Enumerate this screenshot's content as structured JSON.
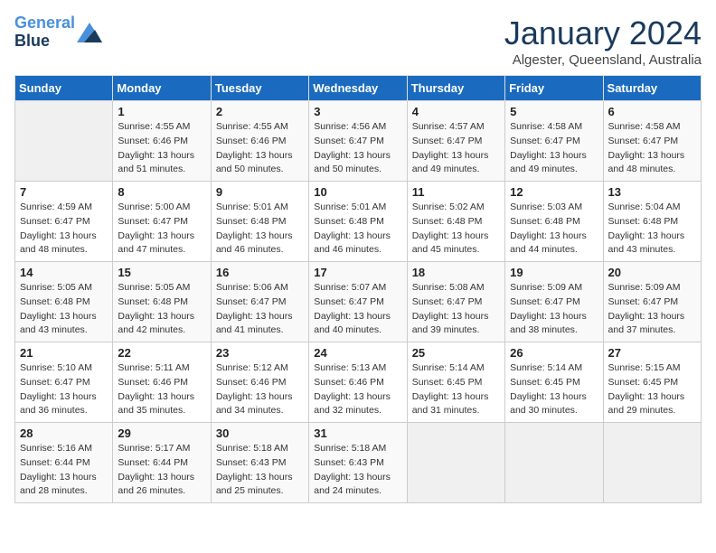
{
  "header": {
    "logo_line1": "General",
    "logo_line2": "Blue",
    "month": "January 2024",
    "location": "Algester, Queensland, Australia"
  },
  "weekdays": [
    "Sunday",
    "Monday",
    "Tuesday",
    "Wednesday",
    "Thursday",
    "Friday",
    "Saturday"
  ],
  "weeks": [
    [
      {
        "day": "",
        "info": ""
      },
      {
        "day": "1",
        "info": "Sunrise: 4:55 AM\nSunset: 6:46 PM\nDaylight: 13 hours\nand 51 minutes."
      },
      {
        "day": "2",
        "info": "Sunrise: 4:55 AM\nSunset: 6:46 PM\nDaylight: 13 hours\nand 50 minutes."
      },
      {
        "day": "3",
        "info": "Sunrise: 4:56 AM\nSunset: 6:47 PM\nDaylight: 13 hours\nand 50 minutes."
      },
      {
        "day": "4",
        "info": "Sunrise: 4:57 AM\nSunset: 6:47 PM\nDaylight: 13 hours\nand 49 minutes."
      },
      {
        "day": "5",
        "info": "Sunrise: 4:58 AM\nSunset: 6:47 PM\nDaylight: 13 hours\nand 49 minutes."
      },
      {
        "day": "6",
        "info": "Sunrise: 4:58 AM\nSunset: 6:47 PM\nDaylight: 13 hours\nand 48 minutes."
      }
    ],
    [
      {
        "day": "7",
        "info": "Sunrise: 4:59 AM\nSunset: 6:47 PM\nDaylight: 13 hours\nand 48 minutes."
      },
      {
        "day": "8",
        "info": "Sunrise: 5:00 AM\nSunset: 6:47 PM\nDaylight: 13 hours\nand 47 minutes."
      },
      {
        "day": "9",
        "info": "Sunrise: 5:01 AM\nSunset: 6:48 PM\nDaylight: 13 hours\nand 46 minutes."
      },
      {
        "day": "10",
        "info": "Sunrise: 5:01 AM\nSunset: 6:48 PM\nDaylight: 13 hours\nand 46 minutes."
      },
      {
        "day": "11",
        "info": "Sunrise: 5:02 AM\nSunset: 6:48 PM\nDaylight: 13 hours\nand 45 minutes."
      },
      {
        "day": "12",
        "info": "Sunrise: 5:03 AM\nSunset: 6:48 PM\nDaylight: 13 hours\nand 44 minutes."
      },
      {
        "day": "13",
        "info": "Sunrise: 5:04 AM\nSunset: 6:48 PM\nDaylight: 13 hours\nand 43 minutes."
      }
    ],
    [
      {
        "day": "14",
        "info": "Sunrise: 5:05 AM\nSunset: 6:48 PM\nDaylight: 13 hours\nand 43 minutes."
      },
      {
        "day": "15",
        "info": "Sunrise: 5:05 AM\nSunset: 6:48 PM\nDaylight: 13 hours\nand 42 minutes."
      },
      {
        "day": "16",
        "info": "Sunrise: 5:06 AM\nSunset: 6:47 PM\nDaylight: 13 hours\nand 41 minutes."
      },
      {
        "day": "17",
        "info": "Sunrise: 5:07 AM\nSunset: 6:47 PM\nDaylight: 13 hours\nand 40 minutes."
      },
      {
        "day": "18",
        "info": "Sunrise: 5:08 AM\nSunset: 6:47 PM\nDaylight: 13 hours\nand 39 minutes."
      },
      {
        "day": "19",
        "info": "Sunrise: 5:09 AM\nSunset: 6:47 PM\nDaylight: 13 hours\nand 38 minutes."
      },
      {
        "day": "20",
        "info": "Sunrise: 5:09 AM\nSunset: 6:47 PM\nDaylight: 13 hours\nand 37 minutes."
      }
    ],
    [
      {
        "day": "21",
        "info": "Sunrise: 5:10 AM\nSunset: 6:47 PM\nDaylight: 13 hours\nand 36 minutes."
      },
      {
        "day": "22",
        "info": "Sunrise: 5:11 AM\nSunset: 6:46 PM\nDaylight: 13 hours\nand 35 minutes."
      },
      {
        "day": "23",
        "info": "Sunrise: 5:12 AM\nSunset: 6:46 PM\nDaylight: 13 hours\nand 34 minutes."
      },
      {
        "day": "24",
        "info": "Sunrise: 5:13 AM\nSunset: 6:46 PM\nDaylight: 13 hours\nand 32 minutes."
      },
      {
        "day": "25",
        "info": "Sunrise: 5:14 AM\nSunset: 6:45 PM\nDaylight: 13 hours\nand 31 minutes."
      },
      {
        "day": "26",
        "info": "Sunrise: 5:14 AM\nSunset: 6:45 PM\nDaylight: 13 hours\nand 30 minutes."
      },
      {
        "day": "27",
        "info": "Sunrise: 5:15 AM\nSunset: 6:45 PM\nDaylight: 13 hours\nand 29 minutes."
      }
    ],
    [
      {
        "day": "28",
        "info": "Sunrise: 5:16 AM\nSunset: 6:44 PM\nDaylight: 13 hours\nand 28 minutes."
      },
      {
        "day": "29",
        "info": "Sunrise: 5:17 AM\nSunset: 6:44 PM\nDaylight: 13 hours\nand 26 minutes."
      },
      {
        "day": "30",
        "info": "Sunrise: 5:18 AM\nSunset: 6:43 PM\nDaylight: 13 hours\nand 25 minutes."
      },
      {
        "day": "31",
        "info": "Sunrise: 5:18 AM\nSunset: 6:43 PM\nDaylight: 13 hours\nand 24 minutes."
      },
      {
        "day": "",
        "info": ""
      },
      {
        "day": "",
        "info": ""
      },
      {
        "day": "",
        "info": ""
      }
    ]
  ]
}
